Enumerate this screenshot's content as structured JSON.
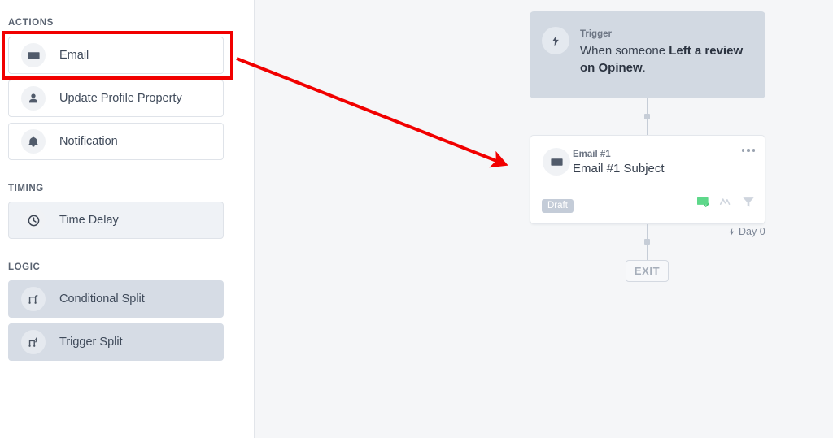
{
  "sidebar": {
    "sections": [
      {
        "title": "ACTIONS",
        "items": [
          {
            "label": "Email",
            "icon": "envelope-icon",
            "style": "plain"
          },
          {
            "label": "Update Profile Property",
            "icon": "person-icon",
            "style": "plain"
          },
          {
            "label": "Notification",
            "icon": "bell-icon",
            "style": "plain"
          }
        ]
      },
      {
        "title": "TIMING",
        "items": [
          {
            "label": "Time Delay",
            "icon": "clock-icon",
            "style": "soft"
          }
        ]
      },
      {
        "title": "LOGIC",
        "items": [
          {
            "label": "Conditional Split",
            "icon": "split-icon",
            "style": "solid"
          },
          {
            "label": "Trigger Split",
            "icon": "trigger-split-icon",
            "style": "solid"
          }
        ]
      }
    ]
  },
  "canvas": {
    "trigger_card": {
      "kicker": "Trigger",
      "icon": "lightning-bolt-icon",
      "body_prefix": "When someone ",
      "body_emphasis": "Left a review on Opinew",
      "body_suffix": "."
    },
    "email_card": {
      "kicker": "Email #1",
      "subject": "Email #1 Subject",
      "icon": "envelope-icon",
      "menu_icon": "ellipsis-icon",
      "badge": "Draft",
      "status_icons": [
        {
          "name": "email-sent-check-icon",
          "color": "#5ed88a"
        },
        {
          "name": "split-path-icon",
          "color": "#cfd5de"
        },
        {
          "name": "filter-funnel-icon",
          "color": "#cfd5de"
        }
      ]
    },
    "day_label": {
      "icon": "lightning-bolt-icon",
      "text": "Day 0"
    },
    "exit_button": {
      "label": "EXIT"
    }
  },
  "annotation": {
    "highlight_target": "Email",
    "highlight_color": "#f10000",
    "arrow_color": "#f10000",
    "arrow_from": "email-sidebar-item",
    "arrow_to": "email-card"
  },
  "colors": {
    "sidebar_bg": "#ffffff",
    "canvas_bg": "#f5f6f8",
    "trigger_card_bg": "#d2d9e2",
    "logic_item_bg": "#d6dce5",
    "accent_red": "#f10000"
  }
}
